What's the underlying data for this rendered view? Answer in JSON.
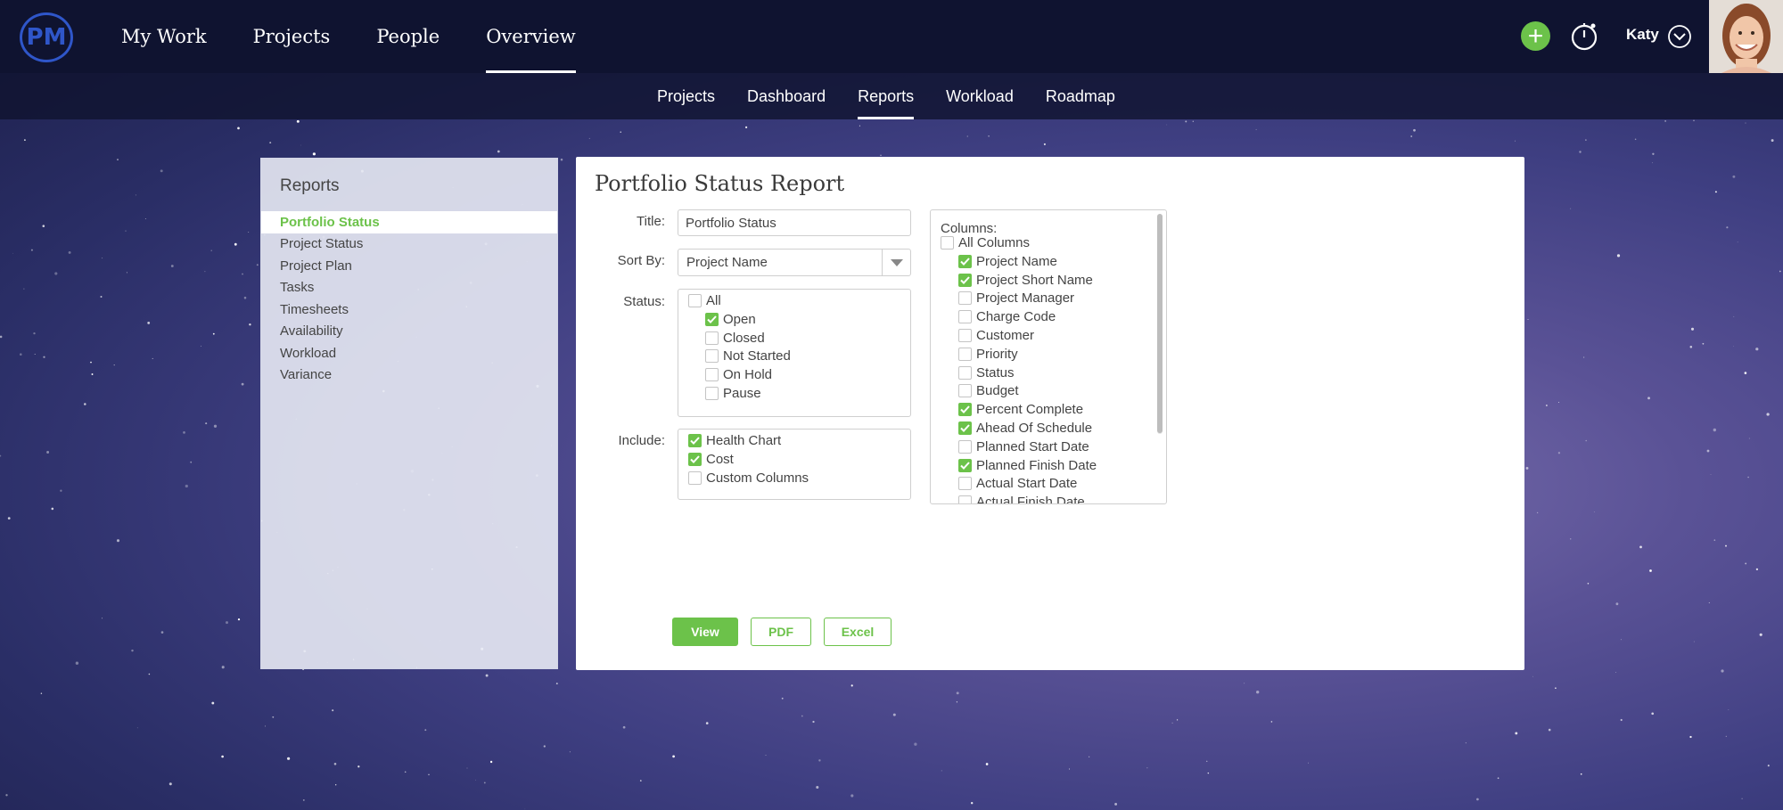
{
  "brand": {
    "logo_text": "PM",
    "accent": "#6cc24a",
    "logo_color": "#2f56c9"
  },
  "main_nav": [
    {
      "label": "My Work",
      "active": false
    },
    {
      "label": "Projects",
      "active": false
    },
    {
      "label": "People",
      "active": false
    },
    {
      "label": "Overview",
      "active": true
    }
  ],
  "header_right": {
    "add_icon": "plus-circle-icon",
    "timer_icon": "stopwatch-icon",
    "user_name": "Katy",
    "dropdown_icon": "chevron-down-circle-icon"
  },
  "sub_nav": [
    {
      "label": "Projects",
      "active": false
    },
    {
      "label": "Dashboard",
      "active": false
    },
    {
      "label": "Reports",
      "active": true
    },
    {
      "label": "Workload",
      "active": false
    },
    {
      "label": "Roadmap",
      "active": false
    }
  ],
  "sidebar": {
    "title": "Reports",
    "items": [
      {
        "label": "Portfolio Status",
        "active": true
      },
      {
        "label": "Project Status",
        "active": false
      },
      {
        "label": "Project Plan",
        "active": false
      },
      {
        "label": "Tasks",
        "active": false
      },
      {
        "label": "Timesheets",
        "active": false
      },
      {
        "label": "Availability",
        "active": false
      },
      {
        "label": "Workload",
        "active": false
      },
      {
        "label": "Variance",
        "active": false
      }
    ]
  },
  "report": {
    "heading": "Portfolio Status Report",
    "title_label": "Title:",
    "title_value": "Portfolio Status",
    "sort_label": "Sort By:",
    "sort_value": "Project Name",
    "status_label": "Status:",
    "status_options": [
      {
        "label": "All",
        "checked": false,
        "indent": false
      },
      {
        "label": "Open",
        "checked": true,
        "indent": true
      },
      {
        "label": "Closed",
        "checked": false,
        "indent": true
      },
      {
        "label": "Not Started",
        "checked": false,
        "indent": true
      },
      {
        "label": "On Hold",
        "checked": false,
        "indent": true
      },
      {
        "label": "Pause",
        "checked": false,
        "indent": true
      }
    ],
    "include_label": "Include:",
    "include_options": [
      {
        "label": "Health Chart",
        "checked": true
      },
      {
        "label": "Cost",
        "checked": true
      },
      {
        "label": "Custom Columns",
        "checked": false
      }
    ],
    "columns_label": "Columns:",
    "columns": [
      {
        "label": "All Columns",
        "checked": false,
        "indent": false
      },
      {
        "label": "Project Name",
        "checked": true,
        "indent": true
      },
      {
        "label": "Project Short Name",
        "checked": true,
        "indent": true
      },
      {
        "label": "Project Manager",
        "checked": false,
        "indent": true
      },
      {
        "label": "Charge Code",
        "checked": false,
        "indent": true
      },
      {
        "label": "Customer",
        "checked": false,
        "indent": true
      },
      {
        "label": "Priority",
        "checked": false,
        "indent": true
      },
      {
        "label": "Status",
        "checked": false,
        "indent": true
      },
      {
        "label": "Budget",
        "checked": false,
        "indent": true
      },
      {
        "label": "Percent Complete",
        "checked": true,
        "indent": true
      },
      {
        "label": "Ahead Of Schedule",
        "checked": true,
        "indent": true
      },
      {
        "label": "Planned Start Date",
        "checked": false,
        "indent": true
      },
      {
        "label": "Planned Finish Date",
        "checked": true,
        "indent": true
      },
      {
        "label": "Actual Start Date",
        "checked": false,
        "indent": true
      },
      {
        "label": "Actual Finish Date",
        "checked": false,
        "indent": true
      }
    ],
    "buttons": {
      "view": "View",
      "pdf": "PDF",
      "excel": "Excel"
    }
  }
}
